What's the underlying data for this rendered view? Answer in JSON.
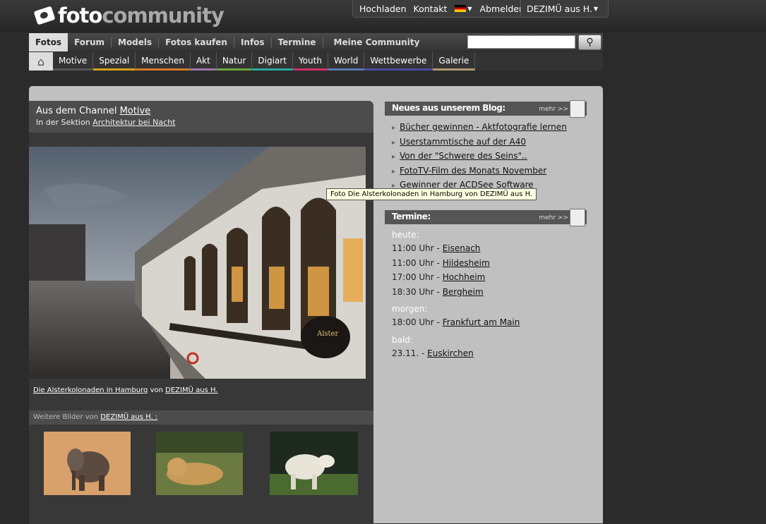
{
  "logo": {
    "word1": "foto",
    "word2": "community"
  },
  "topmenu": {
    "upload": "Hochladen",
    "contact": "Kontakt",
    "logout": "Abmelden",
    "user": "DEZIMÜ aus H."
  },
  "mainnav": [
    "Fotos",
    "Forum",
    "Models",
    "Fotos kaufen",
    "Infos",
    "Termine",
    "Meine Community"
  ],
  "search": {
    "placeholder": ""
  },
  "subnav": [
    {
      "label": "Motive",
      "color": "#555555"
    },
    {
      "label": "Spezial",
      "color": "#d4a017"
    },
    {
      "label": "Menschen",
      "color": "#d47a2a"
    },
    {
      "label": "Akt",
      "color": "#9a7ab0"
    },
    {
      "label": "Natur",
      "color": "#6aa83a"
    },
    {
      "label": "Digiart",
      "color": "#2aa8a0"
    },
    {
      "label": "Youth",
      "color": "#d0306a"
    },
    {
      "label": "World",
      "color": "#5a7ab0"
    },
    {
      "label": "Wettbewerbe",
      "color": "#4a4aa0"
    },
    {
      "label": "Galerie",
      "color": "#b09a70"
    }
  ],
  "channel": {
    "prefix": "Aus dem Channel ",
    "channel": "Motive",
    "section_prefix": "In der Sektion ",
    "section": "Architektur bei Nacht"
  },
  "photo_caption": {
    "title": "Die Alsterkolonaden in Hamburg",
    "by": " von ",
    "author": "DEZIMÜ aus H."
  },
  "more": {
    "prefix": "Weitere Bilder von ",
    "author": "DEZIMÜ aus H. :"
  },
  "blog": {
    "heading": "Neues aus unserem Blog:",
    "more": "mehr >>",
    "items": [
      "Bücher gewinnen - Aktfotografie lernen",
      "Userstammtische auf der A40",
      "Von der \"Schwere des Seins\"..",
      "FotoTV-Film des Monats November",
      "Gewinner der ACDSee Software"
    ]
  },
  "tooltip": "Foto Die Alsterkolonaden in Hamburg von DEZIMÜ aus H.",
  "events": {
    "heading": "Termine:",
    "more": "mehr >>",
    "today_label": "heute:",
    "today": [
      {
        "time": "11:00 Uhr - ",
        "place": "Eisenach"
      },
      {
        "time": "11:00 Uhr - ",
        "place": "Hildesheim"
      },
      {
        "time": "17:00 Uhr - ",
        "place": "Hochheim"
      },
      {
        "time": "18:30 Uhr - ",
        "place": "Bergheim"
      }
    ],
    "tomorrow_label": "morgen:",
    "tomorrow": [
      {
        "time": "18:00 Uhr - ",
        "place": "Frankfurt am Main"
      }
    ],
    "soon_label": "bald:",
    "soon": [
      {
        "time": "23.11. - ",
        "place": "Euskirchen"
      }
    ]
  }
}
